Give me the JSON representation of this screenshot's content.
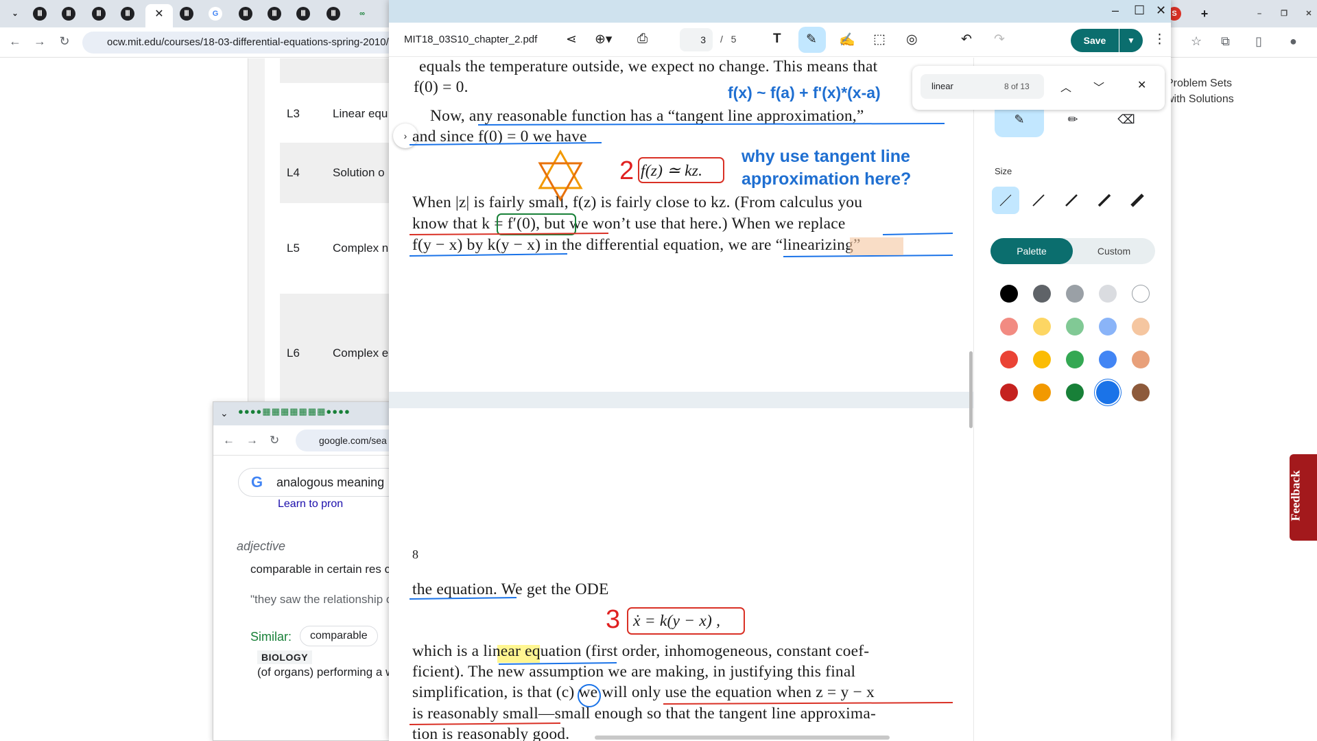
{
  "browser": {
    "url": "ocw.mit.edu/courses/18-03-differential-equations-spring-2010/pa",
    "active_tab_close": "✕",
    "new_tab": "+"
  },
  "lectures": [
    {
      "num": "L3",
      "title": "Linear equ"
    },
    {
      "num": "L4",
      "title": "Solution o"
    },
    {
      "num": "L5",
      "title": "Complex n"
    },
    {
      "num": "L6",
      "title": "Complex e"
    }
  ],
  "right_links": "Problem Sets with Solutions",
  "feedback_label": "Feedback",
  "google_popup": {
    "url": "google.com/sea",
    "query": "analogous meaning",
    "partial_link": "Learn to pron",
    "pos": "adjective",
    "definition": "comparable in certain res compared.",
    "example": "\"they saw the relationship children\"",
    "similar_label": "Similar:",
    "similar_chip": "comparable",
    "category": "BIOLOGY",
    "category_def": "(of organs) performing a wings of insects and bird"
  },
  "pdf": {
    "filename": "MIT18_03S10_chapter_2.pdf",
    "current_page": "3",
    "page_sep": "/",
    "total_pages": "5",
    "save_label": "Save",
    "page_number_8": "8",
    "lines_page3": [
      "equals the temperature outside, we expect no change.  This means that",
      "f(0) = 0.",
      "Now, any reasonable function has a “tangent line approximation,”",
      "and since  f(0) = 0 we have",
      "f(z) ≃ kz.",
      "When |z| is fairly small,  f(z) is fairly close to kz.  (From calculus you",
      "know that k = f′(0), but we won’t use that here.)  When we replace",
      "f(y − x) by k(y − x) in the differential equation, we are “linearizing”"
    ],
    "lines_page8": [
      "the equation.  We get the ODE",
      "ẋ = k(y − x) ,",
      "which is a linear equation (first order, inhomogeneous, constant coef-",
      "ficient).  The new assumption we are making, in justifying this final",
      "simplification, is that (c) we will only use the equation when z = y − x",
      "is reasonably small—small enough so that the tangent line approxima-",
      "tion is reasonably good."
    ],
    "handwritten": {
      "formula": "f(x) ~ f(a) + f'(x)*(x-a)",
      "question": "why use tangent line approximation here?",
      "num2": "2",
      "num3": "3"
    }
  },
  "annotation_panel": {
    "size_label": "Size",
    "tab_palette": "Palette",
    "tab_custom": "Custom",
    "colors": [
      "#000000",
      "#5f6368",
      "#9aa0a6",
      "#dadce0",
      "#ffffff",
      "#f28b82",
      "#fdd663",
      "#81c995",
      "#8ab4f8",
      "#f5c6a0",
      "#ea4335",
      "#fbbc04",
      "#34a853",
      "#4285f4",
      "#e8a07a",
      "#c5221f",
      "#f29900",
      "#188038",
      "#1a73e8",
      "#8d5a3b"
    ]
  },
  "find": {
    "query": "linear",
    "count": "8 of 13"
  }
}
